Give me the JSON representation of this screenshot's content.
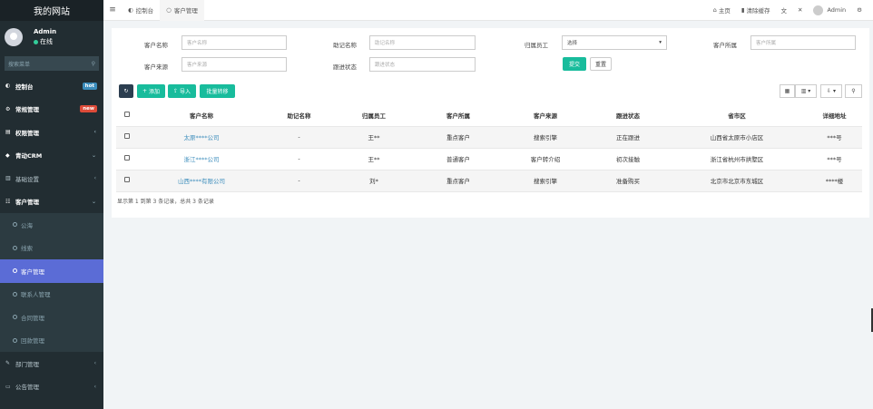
{
  "sidebar": {
    "brand": "我的网站",
    "user": {
      "name": "Admin",
      "status": "在线"
    },
    "search_placeholder": "搜索菜单",
    "items": [
      {
        "icon": "dashboard-icon",
        "glyph": "◐",
        "label": "控制台",
        "badge": "hot",
        "badge_color": "#3c8dbc"
      },
      {
        "icon": "gears-icon",
        "glyph": "⚙",
        "label": "常规管理",
        "badge": "new",
        "badge_color": "#dd4b39"
      },
      {
        "icon": "group-icon",
        "glyph": "▤",
        "label": "权限管理",
        "arrow": "‹"
      },
      {
        "icon": "bullhorn-icon",
        "glyph": "◆",
        "label": "青动CRM",
        "arrow": "⌄"
      },
      {
        "icon": "bank-icon",
        "glyph": "▥",
        "label": "基础设置",
        "arrow": "‹"
      },
      {
        "icon": "list-icon",
        "glyph": "☷",
        "label": "客户管理",
        "arrow": "⌄"
      },
      {
        "label": "公海"
      },
      {
        "label": "线索"
      },
      {
        "label": "客户管理"
      },
      {
        "label": "联系人管理"
      },
      {
        "label": "合同管理"
      },
      {
        "label": "回款管理"
      },
      {
        "icon": "edit-icon",
        "glyph": "✎",
        "label": "部门管理",
        "arrow": "‹"
      },
      {
        "icon": "notice-icon",
        "glyph": "▭",
        "label": "公告管理",
        "arrow": "‹"
      }
    ]
  },
  "navbar": {
    "tabs": [
      "控制台",
      "客户管理"
    ],
    "home": "主页",
    "clear_cache": "清除缓存",
    "admin": "Admin"
  },
  "filters": {
    "customer_name_label": "客户名称",
    "customer_name_ph": "客户名称",
    "mnemonic_label": "助记名称",
    "mnemonic_ph": "助记名称",
    "owner_label": "归属员工",
    "owner_value": "选择",
    "belong_label": "客户所属",
    "belong_ph": "客户所属",
    "source_label": "客户来源",
    "source_ph": "客户来源",
    "follow_label": "跟进状态",
    "follow_ph": "跟进状态",
    "submit": "提交",
    "reset": "重置"
  },
  "toolbar": {
    "add": "添加",
    "import": "导入",
    "transfer": "批量转移"
  },
  "table": {
    "headers": [
      "客户名称",
      "助记名称",
      "归属员工",
      "客户所属",
      "客户来源",
      "跟进状态",
      "省市区",
      "详细地址"
    ],
    "rows": [
      [
        "太原****公司",
        "-",
        "王**",
        "重点客户",
        "搜索引擎",
        "正在跟进",
        "山西省太原市小店区",
        "***号"
      ],
      [
        "浙江****公司",
        "-",
        "王**",
        "普通客户",
        "客户转介绍",
        "初次接触",
        "浙江省杭州市拱墅区",
        "***号"
      ],
      [
        "山西****有限公司",
        "-",
        "刘*",
        "重点客户",
        "搜索引擎",
        "准备购买",
        "北京市北京市东城区",
        "****楼"
      ]
    ],
    "summary": "显示第 1 到第 3 条记录，总共 3 条记录"
  },
  "colors": {
    "sidebar_bg": "#222d32",
    "active_item": "#5b6cd6",
    "accent_green": "#18bc9c",
    "link": "#3c8dbc"
  }
}
